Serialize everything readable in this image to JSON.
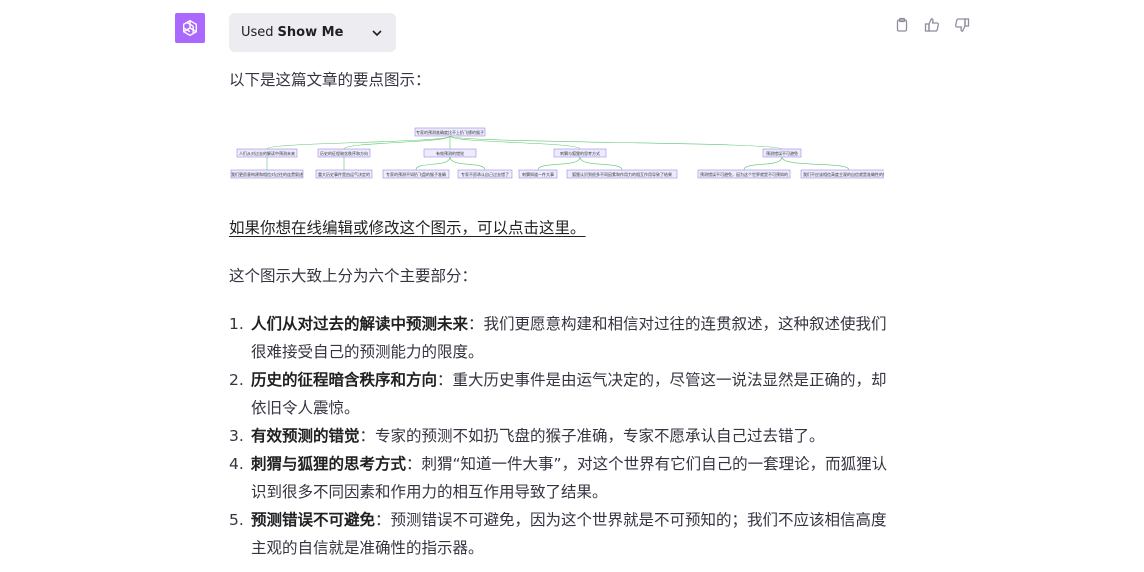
{
  "message": {
    "tool": {
      "prefix": "Used",
      "name": "Show Me"
    },
    "intro": "以下是这篇文章的要点图示：",
    "diagram": {
      "root": "专家的预测准确度比不上扔飞镖的猴子",
      "branches": [
        {
          "label": "人们从对过去的解读中预测未来",
          "children": [
            "我们更愿意构建和相信对过往的连贯叙述"
          ]
        },
        {
          "label": "历史的征程暗含秩序和方向",
          "children": [
            "重大历史事件是由运气决定的"
          ]
        },
        {
          "label": "有效预测的错觉",
          "children": [
            "专家的预测不如扔飞盘的猴子准确",
            "专家不愿承认自己过去错了"
          ]
        },
        {
          "label": "刺猬与狐狸的思考方式",
          "children": [
            "刺猬知道一件大事",
            "狐狸认识到很多不同因素和作用力的相互作用导致了结果"
          ]
        },
        {
          "label": "预测错误不可避免",
          "children": [
            "预测错误不可避免，因为这个世界就是不可预知的",
            "我们不应该相信高度主观的自信就是准确性的指示器"
          ]
        }
      ]
    },
    "edit_link": "如果你想在线编辑或修改这个图示，可以点击这里。",
    "summary": "这个图示大致上分为六个主要部分：",
    "points": [
      {
        "num": "1.",
        "title": "人们从对过去的解读中预测未来",
        "text": "：我们更愿意构建和相信对过往的连贯叙述，这种叙述使我们很难接受自己的预测能力的限度。"
      },
      {
        "num": "2.",
        "title": "历史的征程暗含秩序和方向",
        "text": "：重大历史事件是由运气决定的，尽管这一说法显然是正确的，却依旧令人震惊。"
      },
      {
        "num": "3.",
        "title": "有效预测的错觉",
        "text": "：专家的预测不如扔飞盘的猴子准确，专家不愿承认自己过去错了。"
      },
      {
        "num": "4.",
        "title": "刺猬与狐狸的思考方式",
        "text": "：刺猬“知道一件大事”，对这个世界有它们自己的一套理论，而狐狸认识到很多不同因素和作用力的相互作用导致了结果。"
      },
      {
        "num": "5.",
        "title": "预测错误不可避免",
        "text": "：预测错误不可避免，因为这个世界就是不可预知的；我们不应该相信高度主观的自信就是准确性的指示器。"
      }
    ]
  },
  "colors": {
    "avatar": "#ab68ff",
    "text": "#343541",
    "pill": "#ececf1",
    "edge": "#5bc56f",
    "node_fill": "#ececff",
    "node_stroke": "#9370db"
  },
  "icons": {
    "avatar": "openai-logo-icon",
    "chevron": "chevron-down-icon",
    "copy": "clipboard-icon",
    "like": "thumbs-up-icon",
    "dislike": "thumbs-down-icon"
  }
}
